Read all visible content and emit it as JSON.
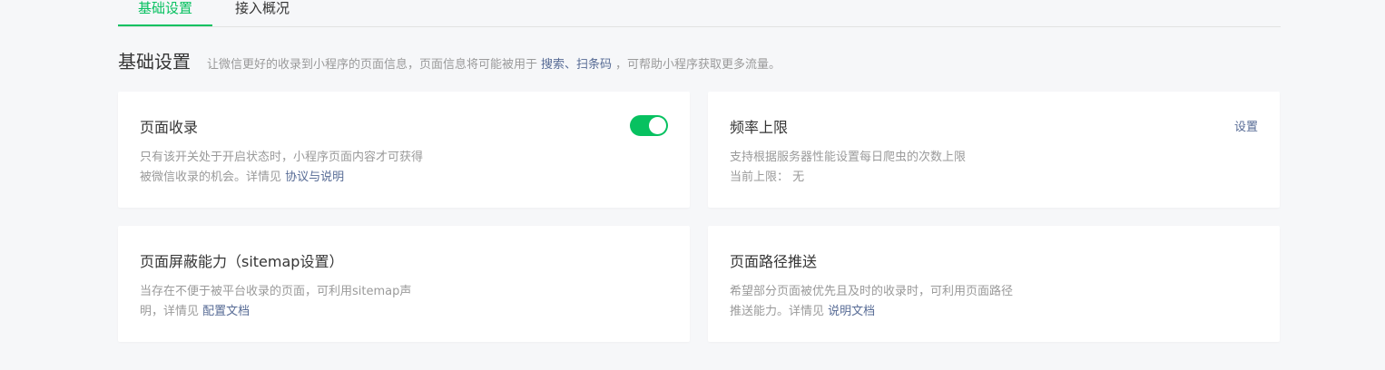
{
  "tabs": {
    "basic": "基础设置",
    "overview": "接入概况"
  },
  "section": {
    "title": "基础设置",
    "desc_prefix": "让微信更好的收录到小程序的页面信息，页面信息将可能被用于",
    "desc_link": "搜索、扫条码",
    "desc_suffix": "，可帮助小程序获取更多流量。"
  },
  "cards": {
    "page_index": {
      "title": "页面收录",
      "desc_line1": "只有该开关处于开启状态时，小程序页面内容才可获得",
      "desc_line2_prefix": "被微信收录的机会。详情见",
      "link": "协议与说明",
      "toggle_on": true
    },
    "rate_limit": {
      "title": "频率上限",
      "action": "设置",
      "desc_line1": "支持根据服务器性能设置每日爬虫的次数上限",
      "desc_line2": "当前上限： 无"
    },
    "sitemap": {
      "title": "页面屏蔽能力（sitemap设置）",
      "desc_line1": "当存在不便于被平台收录的页面，可利用sitemap声",
      "desc_line2_prefix": "明，详情见",
      "link": "配置文档"
    },
    "path_push": {
      "title": "页面路径推送",
      "desc_line1": "希望部分页面被优先且及时的收录时，可利用页面路径",
      "desc_line2_prefix": "推送能力。详情见",
      "link": "说明文档"
    }
  },
  "colors": {
    "accent": "#07c160",
    "link": "#576b95",
    "muted": "#9a9a9a"
  }
}
